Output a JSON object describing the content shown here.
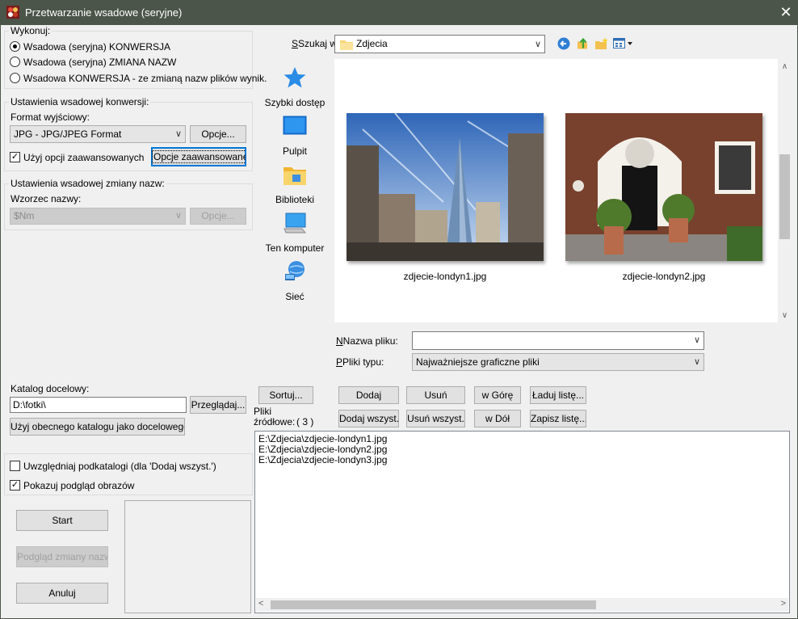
{
  "window": {
    "title": "Przetwarzanie wsadowe (seryjne)",
    "close_label": "✕"
  },
  "execute_group": {
    "label": "Wykonuj:",
    "options": [
      {
        "label": "Wsadowa (seryjna) KONWERSJA",
        "selected": true
      },
      {
        "label": "Wsadowa (seryjna) ZMIANA NAZW",
        "selected": false
      },
      {
        "label": "Wsadowa  KONWERSJA - ze zmianą nazw plików wynik.",
        "selected": false
      }
    ]
  },
  "conversion_group": {
    "label": "Ustawienia wsadowej konwersji:",
    "format_label": "Format wyjściowy:",
    "format_value": "JPG - JPG/JPEG Format",
    "options_button": "Opcje...",
    "advanced_checkbox_label": "Użyj opcji zaawansowanych",
    "advanced_checked": true,
    "advanced_button": "Opcje zaawansowane..."
  },
  "rename_group": {
    "label": "Ustawienia wsadowej zmiany nazw:",
    "pattern_label": "Wzorzec nazwy:",
    "pattern_value": "$Nm",
    "options_button": "Opcje..."
  },
  "browser": {
    "look_in_label": "Szukaj w:",
    "look_in_value": "Zdjecia",
    "places": [
      "Szybki dostęp",
      "Pulpit",
      "Biblioteki",
      "Ten komputer",
      "Sieć"
    ],
    "files": [
      "zdjecie-londyn1.jpg",
      "zdjecie-londyn2.jpg"
    ],
    "filename_label": "Nazwa pliku:",
    "filename_value": "",
    "filetype_label": "Pliki typu:",
    "filetype_value": "Najważniejsze graficzne pliki"
  },
  "target": {
    "label": "Katalog docelowy:",
    "path": "D:\\fotki\\",
    "browse_button": "Przeglądaj...",
    "use_current_button": "Użyj obecnego katalogu jako docelowego"
  },
  "options": {
    "subfolders_label": "Uwzględniaj podkatalogi  (dla 'Dodaj wszyst.')",
    "subfolders_checked": false,
    "preview_label": "Pokazuj podgląd obrazów",
    "preview_checked": true
  },
  "actions": {
    "start": "Start",
    "rename_preview": "Podgląd zmiany nazw",
    "cancel": "Anuluj"
  },
  "source": {
    "sort_button": "Sortuj...",
    "label_line1": "Pliki",
    "label_line2": "źródłowe:",
    "count": "( 3 )",
    "add": "Dodaj",
    "remove": "Usuń",
    "up": "w Górę",
    "load_list": "Ładuj listę...",
    "add_all": "Dodaj wszyst.",
    "remove_all": "Usuń wszyst.",
    "down": "w Dół",
    "save_list": "Zapisz listę...",
    "files": [
      "E:\\Zdjecia\\zdjecie-londyn1.jpg",
      "E:\\Zdjecia\\zdjecie-londyn2.jpg",
      "E:\\Zdjecia\\zdjecie-londyn3.jpg"
    ]
  },
  "icons": {
    "app": "app-icon",
    "folder": "folder-icon",
    "back": "back-icon",
    "up": "up-folder-icon",
    "new_folder": "new-folder-icon",
    "view_menu": "view-menu-icon"
  },
  "colors": {
    "titlebar": "#4b5549",
    "focus": "#0078d7"
  }
}
